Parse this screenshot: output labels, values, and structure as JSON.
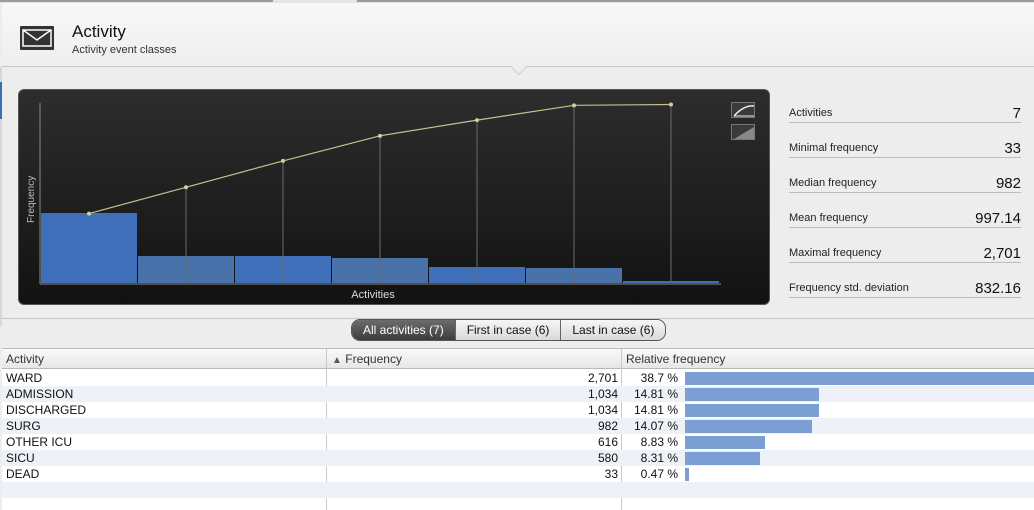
{
  "header": {
    "title": "Activity",
    "subtitle": "Activity event classes",
    "icon": "envelope-icon"
  },
  "chart": {
    "ylabel": "Frequency",
    "xlabel": "Activities",
    "controls": [
      "cumulative-line-icon",
      "area-icon"
    ]
  },
  "chart_data": {
    "type": "bar",
    "categories": [
      "WARD",
      "ADMISSION",
      "DISCHARGED",
      "SURG",
      "OTHER ICU",
      "SICU",
      "DEAD"
    ],
    "series": [
      {
        "type": "bar",
        "values": [
          2701,
          1034,
          1034,
          982,
          616,
          580,
          33
        ]
      },
      {
        "type": "line",
        "values": [
          38.7,
          53.51,
          68.32,
          82.39,
          91.22,
          99.53,
          100.0
        ]
      }
    ],
    "xlabel": "Activities",
    "ylabel": "Frequency",
    "ylim": [
      0,
      2701
    ],
    "grid": false,
    "colors": {
      "bar": "#3e6fb8",
      "line": "#c8bf8e"
    }
  },
  "stats": [
    {
      "label": "Activities",
      "value": "7"
    },
    {
      "label": "Minimal frequency",
      "value": "33"
    },
    {
      "label": "Median frequency",
      "value": "982"
    },
    {
      "label": "Mean frequency",
      "value": "997.14"
    },
    {
      "label": "Maximal frequency",
      "value": "2,701"
    },
    {
      "label": "Frequency std. deviation",
      "value": "832.16"
    }
  ],
  "tabs": [
    {
      "label": "All activities (7)",
      "active": true
    },
    {
      "label": "First in case (6)",
      "active": false
    },
    {
      "label": "Last in case (6)",
      "active": false
    }
  ],
  "table": {
    "columns": [
      "Activity",
      "Frequency",
      "Relative frequency"
    ],
    "sort_icon": "sort-ascending-icon",
    "rows": [
      {
        "activity": "WARD",
        "frequency": "2,701",
        "relative": "38.7 %",
        "fraction": 0.387
      },
      {
        "activity": "ADMISSION",
        "frequency": "1,034",
        "relative": "14.81 %",
        "fraction": 0.1481
      },
      {
        "activity": "DISCHARGED",
        "frequency": "1,034",
        "relative": "14.81 %",
        "fraction": 0.1481
      },
      {
        "activity": "SURG",
        "frequency": "982",
        "relative": "14.07 %",
        "fraction": 0.1407
      },
      {
        "activity": "OTHER ICU",
        "frequency": "616",
        "relative": "8.83 %",
        "fraction": 0.0883
      },
      {
        "activity": "SICU",
        "frequency": "580",
        "relative": "8.31 %",
        "fraction": 0.0831
      },
      {
        "activity": "DEAD",
        "frequency": "33",
        "relative": "0.47 %",
        "fraction": 0.0047
      }
    ]
  }
}
